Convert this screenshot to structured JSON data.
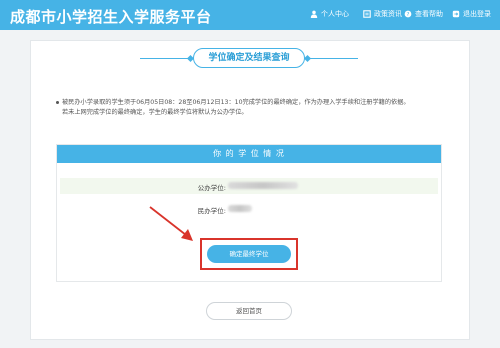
{
  "header": {
    "site_title": "成都市小学招生入学服务平台",
    "nav": [
      {
        "icon": "user-icon",
        "label": "个人中心"
      },
      {
        "icon": "news-icon",
        "label": "政策资讯"
      },
      {
        "icon": "help-icon",
        "label": "查看帮助"
      },
      {
        "icon": "logout-icon",
        "label": "退出登录"
      }
    ]
  },
  "page": {
    "title": "学位确定及结果查询",
    "notice_line1": "被民办小学录取的学生须于06月05日08：28至06月12日13：10完成学位的最终确定，作为办理入学手续和注册学籍的依据。",
    "notice_line2": "若未上网完成学位的最终确定，学生的最终学位将默认为公办学位。"
  },
  "card": {
    "heading": "你 的 学 位 情 况",
    "public_label": "公办学位:",
    "private_label": "民办学位:"
  },
  "buttons": {
    "confirm": "确定最终学位",
    "back": "返回首页"
  },
  "colors": {
    "primary": "#46b3e6",
    "annotation_red": "#d9342b"
  }
}
